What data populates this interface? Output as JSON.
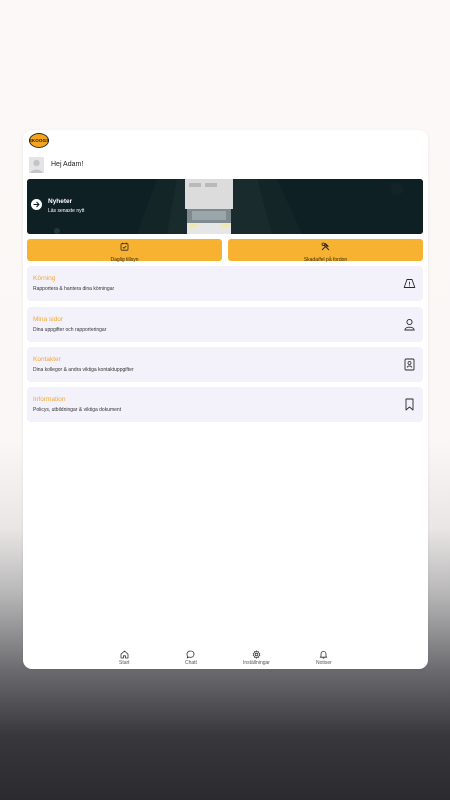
{
  "header": {
    "logo_text": "SKOOGS",
    "greeting": "Hej Adam!"
  },
  "banner": {
    "title": "Nyheter",
    "subtitle": "Läs senaste nytt",
    "arrow_icon": "arrow-right-icon"
  },
  "actions": [
    {
      "label": "Daglig tillsyn",
      "icon": "calendar-check-icon"
    },
    {
      "label": "Skada/fel på fordon",
      "icon": "hammer-wrench-icon"
    }
  ],
  "menu": [
    {
      "title": "Körning",
      "description": "Rapportera & hantera dina körningar",
      "icon": "road-warning-icon"
    },
    {
      "title": "Mina sidor",
      "description": "Dina uppgifter och rapporteringar",
      "icon": "user-icon"
    },
    {
      "title": "Kontakter",
      "description": "Dina kollegor & andra viktiga kontaktuppgifter",
      "icon": "contact-card-icon"
    },
    {
      "title": "Information",
      "description": "Policys, utbildningar & viktiga dokument",
      "icon": "bookmark-icon"
    }
  ],
  "tabbar": [
    {
      "label": "Start",
      "icon": "home-icon"
    },
    {
      "label": "Chatt",
      "icon": "chat-icon"
    },
    {
      "label": "Inställningar",
      "icon": "gear-icon"
    },
    {
      "label": "Notiser",
      "icon": "bell-icon"
    }
  ],
  "colors": {
    "accent": "#f8b232",
    "menu_title": "#f3a634",
    "menu_bg": "#f3f2fb",
    "banner_bg": "#0f2025"
  }
}
